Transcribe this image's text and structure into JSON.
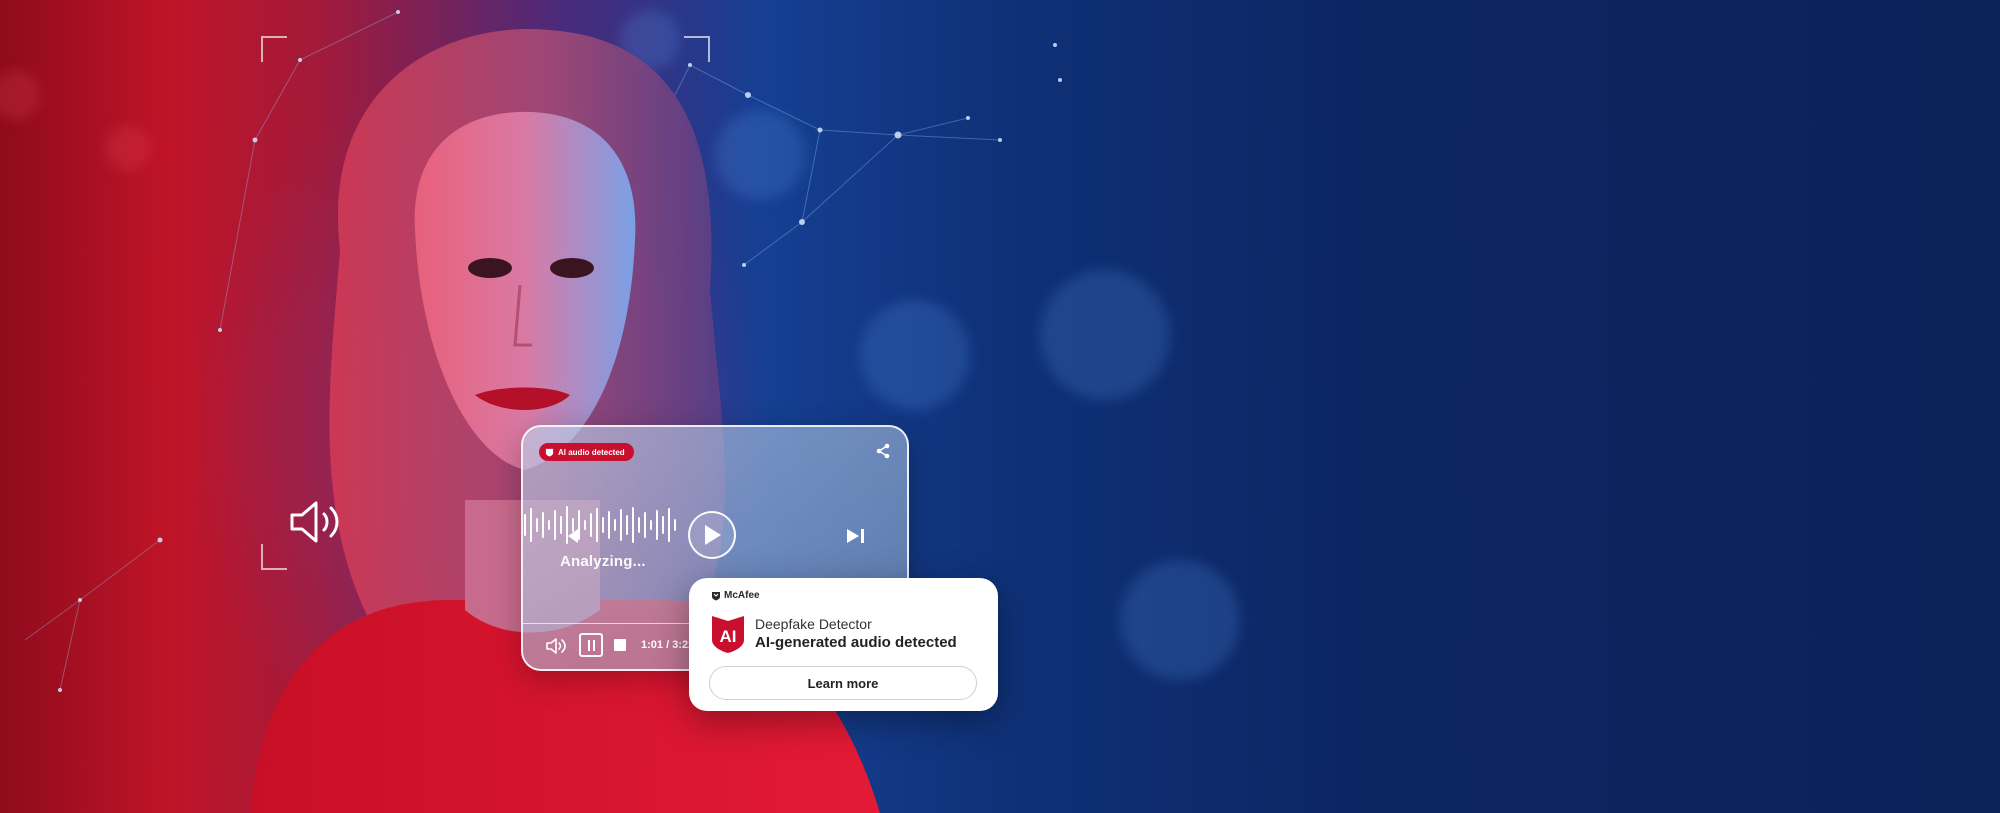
{
  "colors": {
    "accent_red": "#c8102e",
    "deep_blue": "#0b2258",
    "white": "#ffffff"
  },
  "icons": [
    "speaker-icon",
    "mcafee-shield-icon",
    "share-icon",
    "waveform-icon",
    "skip-back-icon",
    "play-icon",
    "skip-forward-icon",
    "volume-icon",
    "pause-icon",
    "stop-icon",
    "ai-shield-icon"
  ],
  "player": {
    "badge_label": "AI audio detected",
    "status": "Analyzing...",
    "time": "1:01 / 3:22"
  },
  "card": {
    "brand": "McAfee",
    "logo_text": "AI",
    "title": "Deepfake Detector",
    "subtitle": "AI-generated audio detected",
    "button_label": "Learn more"
  }
}
